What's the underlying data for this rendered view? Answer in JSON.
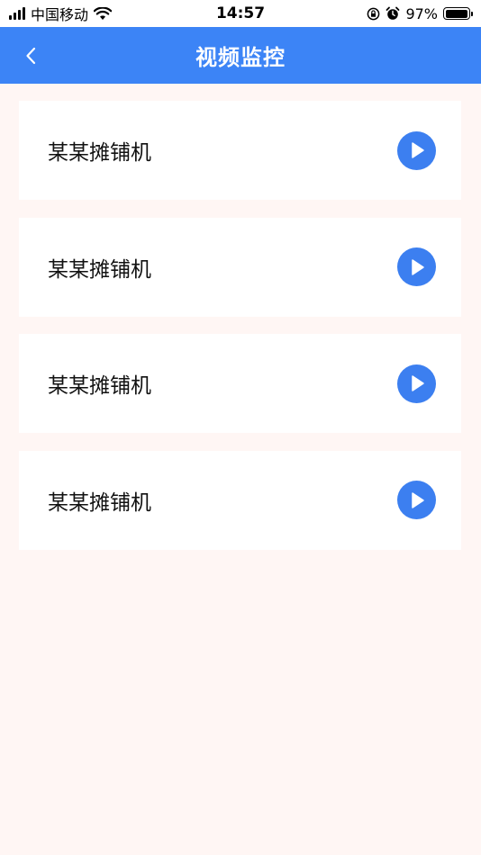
{
  "status_bar": {
    "carrier": "中国移动",
    "time": "14:57",
    "battery_percent": "97%",
    "battery_level": 0.97,
    "icons": [
      "signal-icon",
      "wifi-icon",
      "orientation-lock-icon",
      "alarm-icon",
      "battery-icon"
    ]
  },
  "header": {
    "title": "视频监控",
    "back_icon": "back-chevron-icon"
  },
  "colors": {
    "accent": "#3c84f6",
    "play_button": "#3c7ff0",
    "background": "#fff6f4",
    "card": "#ffffff"
  },
  "devices": [
    {
      "name": "某某摊铺机",
      "action_icon": "play-icon"
    },
    {
      "name": "某某摊铺机",
      "action_icon": "play-icon"
    },
    {
      "name": "某某摊铺机",
      "action_icon": "play-icon"
    },
    {
      "name": "某某摊铺机",
      "action_icon": "play-icon"
    }
  ]
}
